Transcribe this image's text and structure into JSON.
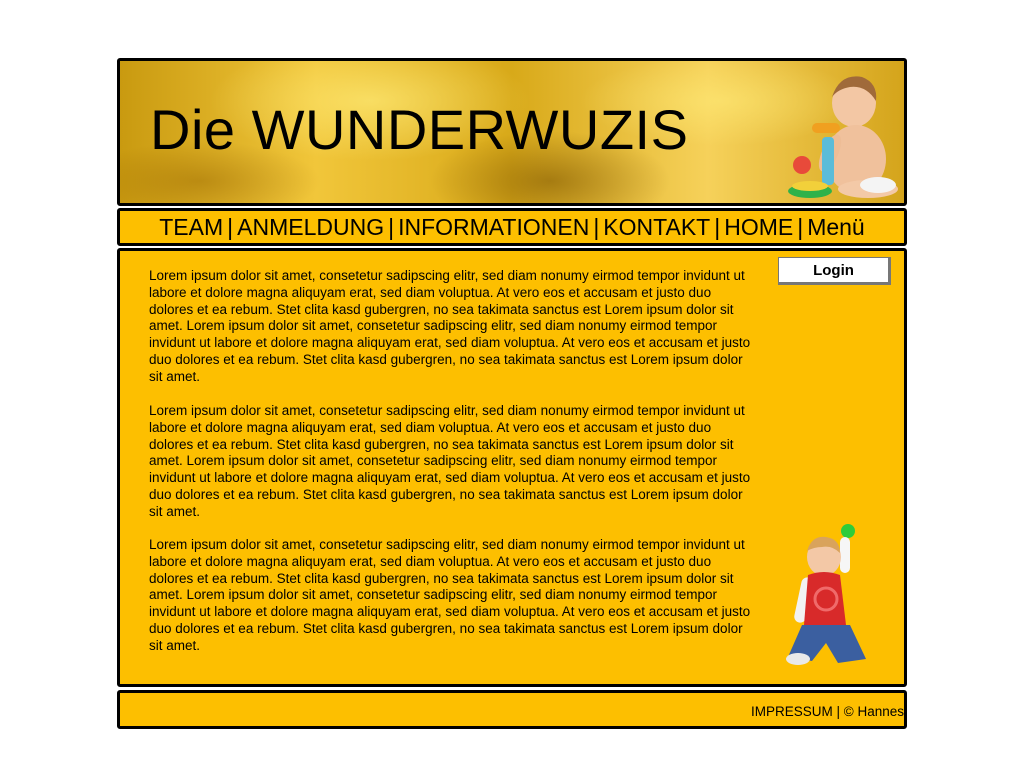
{
  "header": {
    "title": "Die WUNDERWUZIS"
  },
  "nav": {
    "items": [
      "TEAM",
      "ANMELDUNG",
      "INFORMATIONEN",
      "KONTAKT",
      "HOME",
      "Menü"
    ],
    "separator": "|"
  },
  "content": {
    "login_label": "Login",
    "paragraphs": [
      "Lorem ipsum dolor sit amet, consetetur sadipscing elitr, sed diam nonumy eirmod tempor invidunt ut labore et dolore magna aliquyam erat, sed diam voluptua. At vero eos et accusam et justo duo dolores et ea rebum. Stet clita kasd gubergren, no sea takimata sanctus est Lorem ipsum dolor sit amet. Lorem ipsum dolor sit amet, consetetur sadipscing elitr, sed diam nonumy eirmod tempor invidunt ut labore et dolore magna aliquyam erat, sed diam voluptua. At vero eos et accusam et justo duo dolores et ea rebum. Stet clita kasd gubergren, no sea takimata sanctus est Lorem ipsum dolor sit amet.",
      "Lorem ipsum dolor sit amet, consetetur sadipscing elitr, sed diam nonumy eirmod tempor invidunt ut labore et dolore magna aliquyam erat, sed diam voluptua. At vero eos et accusam et justo duo dolores et ea rebum. Stet clita kasd gubergren, no sea takimata sanctus est Lorem ipsum dolor sit amet. Lorem ipsum dolor sit amet, consetetur sadipscing elitr, sed diam nonumy eirmod tempor invidunt ut labore et dolore magna aliquyam erat, sed diam voluptua. At vero eos et accusam et justo duo dolores et ea rebum. Stet clita kasd gubergren, no sea takimata sanctus est Lorem ipsum dolor sit amet.",
      "Lorem ipsum dolor sit amet, consetetur sadipscing elitr, sed diam nonumy eirmod tempor invidunt ut labore et dolore magna aliquyam erat, sed diam voluptua. At vero eos et accusam et justo duo dolores et ea rebum. Stet clita kasd gubergren, no sea takimata sanctus est Lorem ipsum dolor sit amet. Lorem ipsum dolor sit amet, consetetur sadipscing elitr, sed diam nonumy eirmod tempor invidunt ut labore et dolore magna aliquyam erat, sed diam voluptua. At vero eos et accusam et justo duo dolores et ea rebum. Stet clita kasd gubergren, no sea takimata sanctus est Lorem ipsum dolor sit amet."
    ]
  },
  "footer": {
    "text": "IMPRESSUM | © Hannes"
  },
  "colors": {
    "panel": "#fdbf00",
    "border": "#000000",
    "header_gold": "#e2b42a"
  },
  "icons": {
    "header_image": "baby-with-ring-toy-photo",
    "content_image": "toddler-with-ball-photo"
  }
}
